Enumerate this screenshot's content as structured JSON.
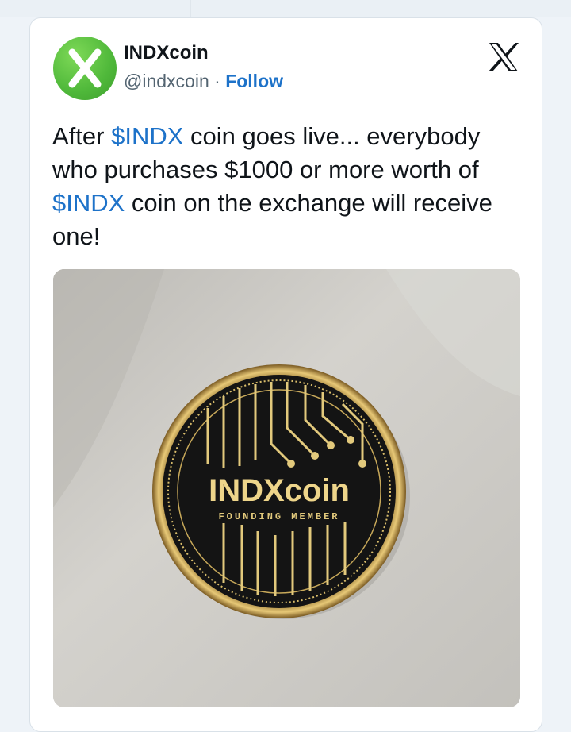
{
  "tweet": {
    "author": {
      "display_name": "INDXcoin",
      "handle": "@indxcoin",
      "separator": "·",
      "follow_label": "Follow",
      "avatar_letter": "X"
    },
    "text_parts": [
      "After ",
      "$INDX",
      " coin goes live... everybody who purchases $1000 or more worth of ",
      "$INDX",
      " coin on the exchange will receive one!"
    ],
    "platform_icon": "x-logo-icon",
    "media": {
      "description_icon": "coin-photo",
      "coin_title": "INDXcoin",
      "coin_subtitle": "FOUNDING MEMBER"
    }
  },
  "colors": {
    "accent": "#1d72c9",
    "text": "#0f1419",
    "secondary": "#536471",
    "avatar_green": "#4fb83a"
  }
}
